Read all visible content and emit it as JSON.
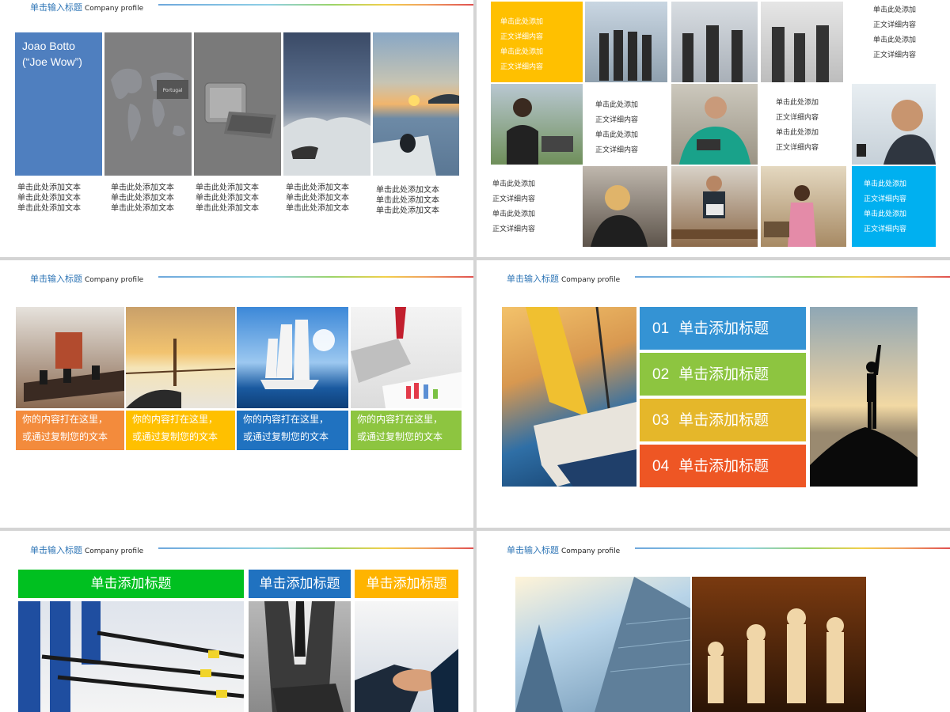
{
  "header": {
    "title": "单击输入标题",
    "subtitle": "Company profile"
  },
  "colors": {
    "blue": "#4f7fbf",
    "yellow": "#ffc000",
    "cyan": "#00b0f0",
    "orange": "#f38b3c",
    "green": "#8dc540",
    "red": "#ee5624",
    "gold": "#e5b72a"
  },
  "slide1": {
    "name_line1": "Joao Botto",
    "name_line2": "(“Joe Wow”)",
    "map_label": "Portugal",
    "caption_line": "单击此处添加文本"
  },
  "slide2": {
    "text_a": "单击此处添加",
    "text_b": "正文详细内容"
  },
  "slide3": {
    "strip_line1": "你的内容打在这里，",
    "strip_line2": "或通过复制您的文本"
  },
  "slide4": {
    "items": [
      {
        "num": "01",
        "label": "单击添加标题"
      },
      {
        "num": "02",
        "label": "单击添加标题"
      },
      {
        "num": "03",
        "label": "单击添加标题"
      },
      {
        "num": "04",
        "label": "单击添加标题"
      }
    ]
  },
  "slide5": {
    "titles": [
      "单击添加标题",
      "单击添加标题",
      "单击添加标题"
    ]
  }
}
